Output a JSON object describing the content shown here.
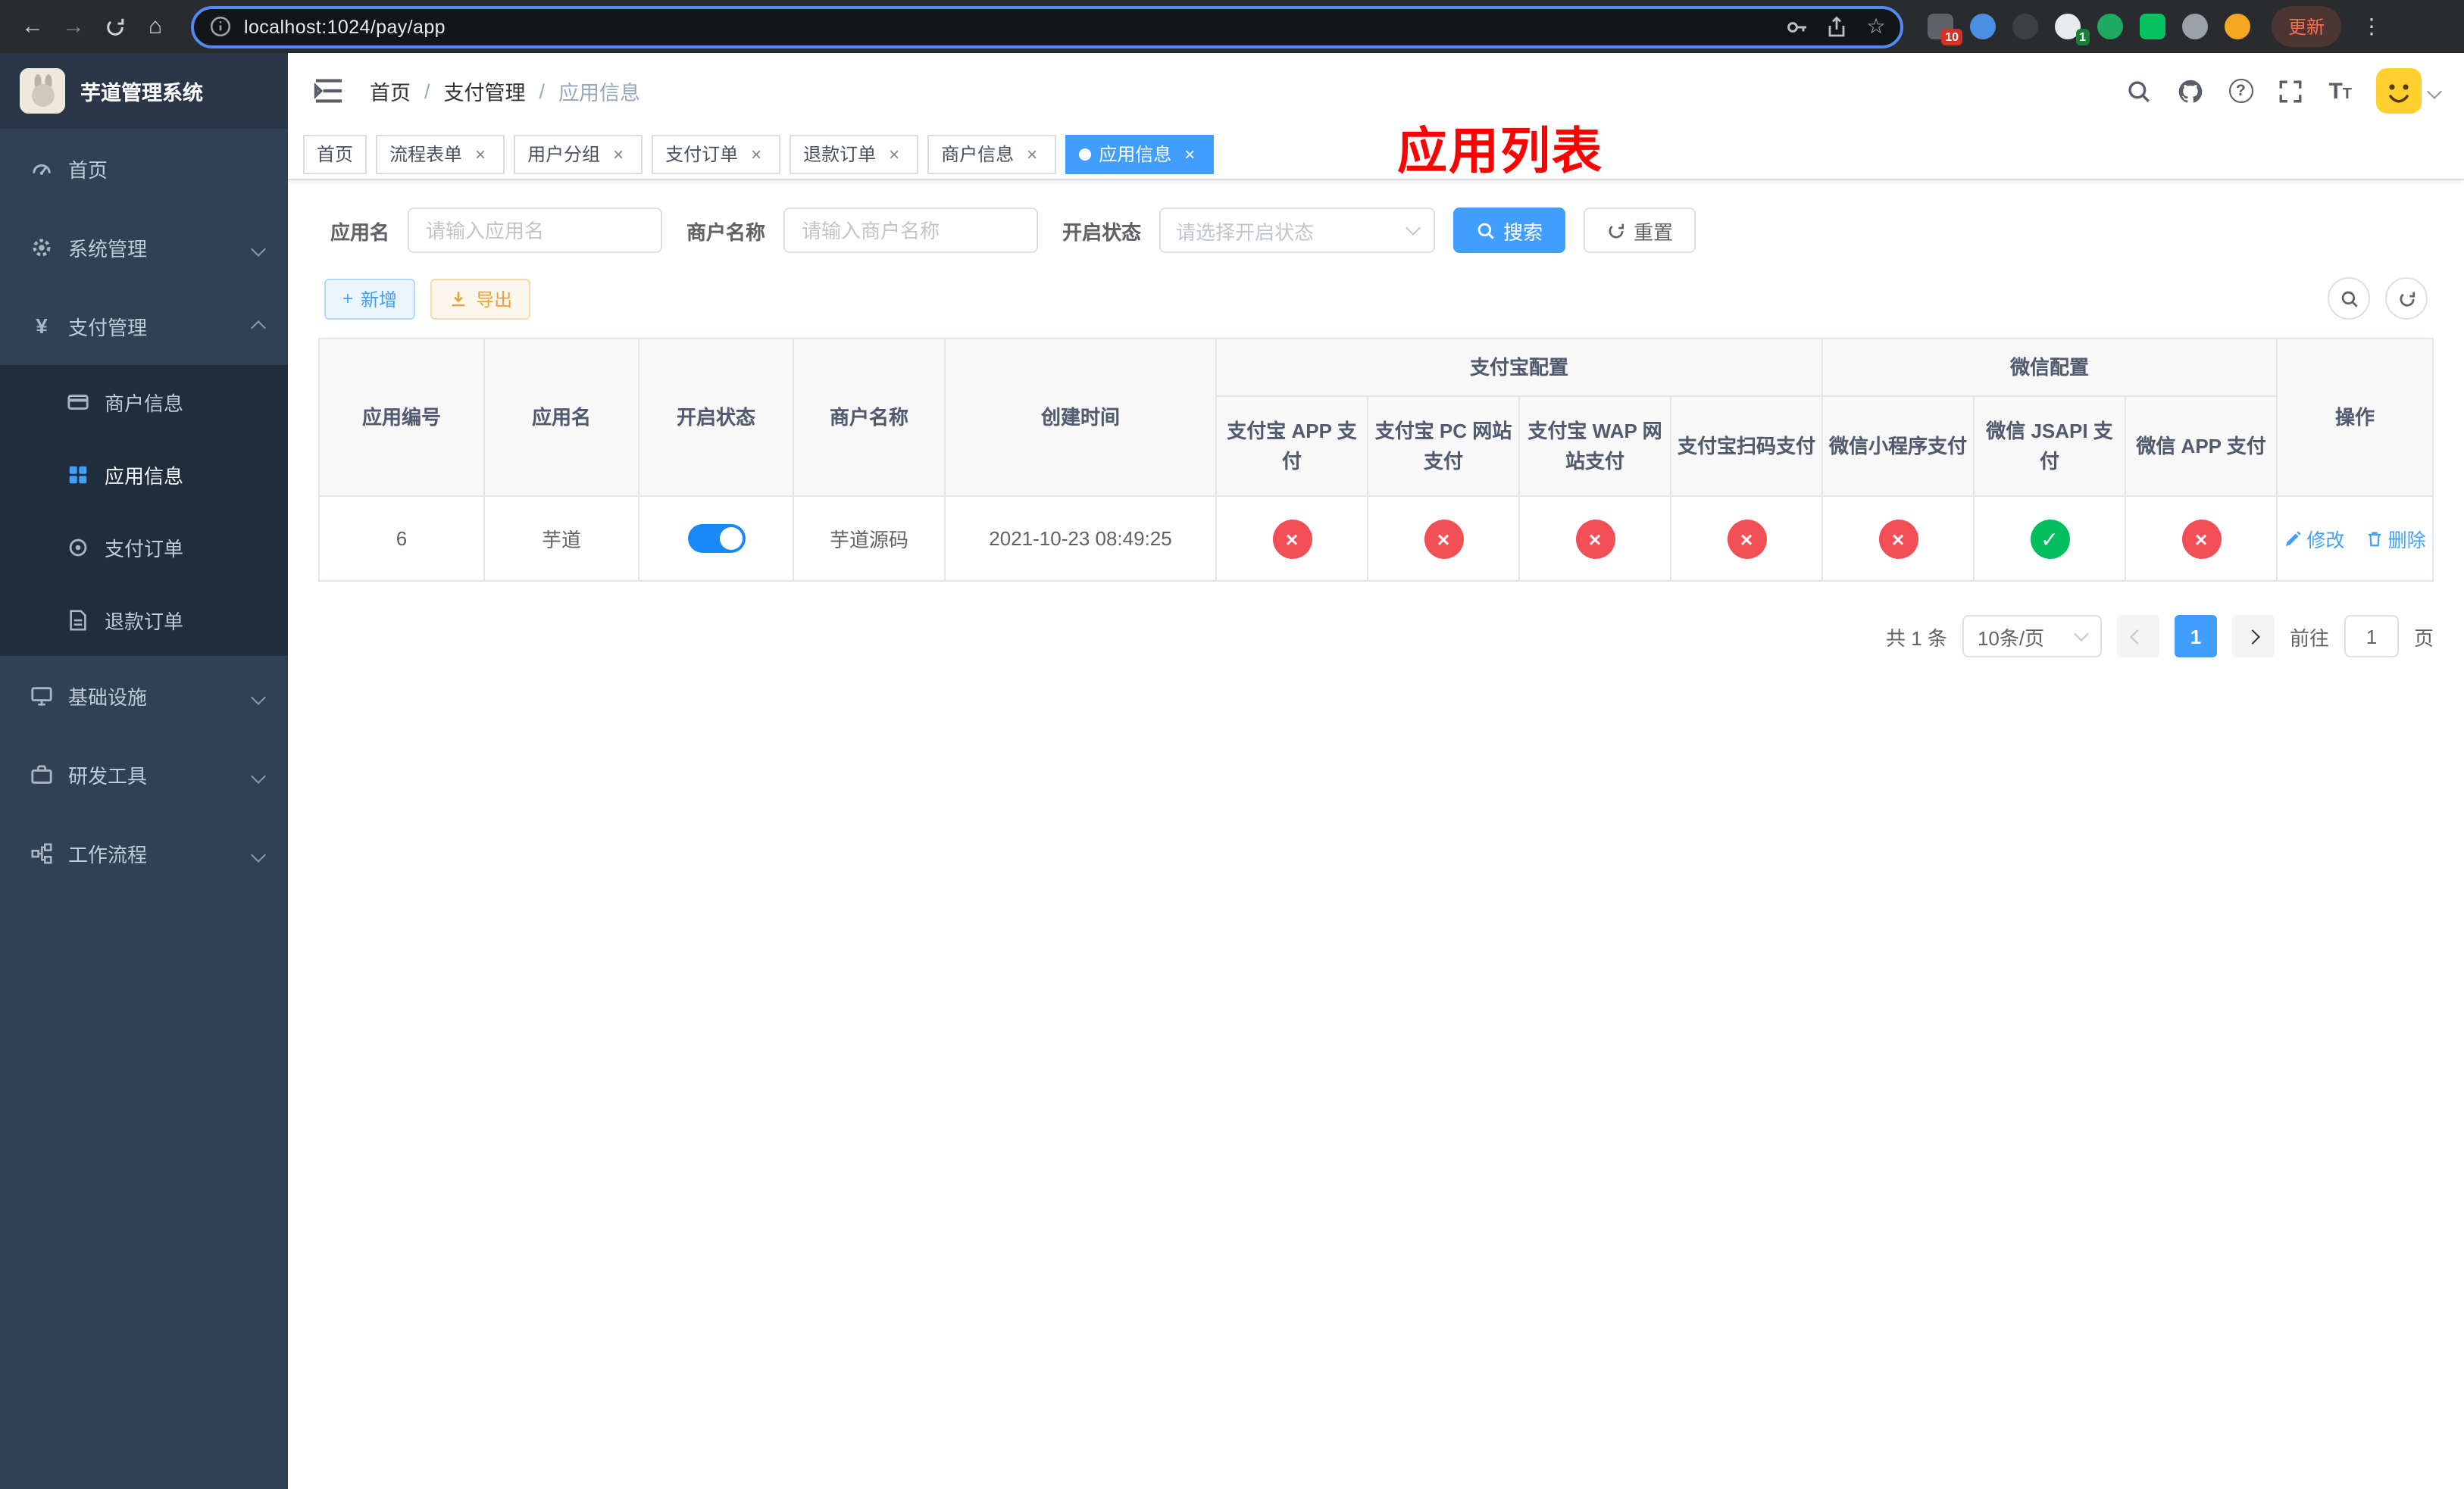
{
  "annotation": {
    "title": "应用列表"
  },
  "browser": {
    "url": "localhost:1024/pay/app",
    "update_label": "更新",
    "extension_badge_1": "10",
    "extension_badge_2": "1"
  },
  "sidebar": {
    "title": "芋道管理系统",
    "items": [
      {
        "label": "首页"
      },
      {
        "label": "系统管理"
      },
      {
        "label": "支付管理"
      },
      {
        "label": "基础设施"
      },
      {
        "label": "研发工具"
      },
      {
        "label": "工作流程"
      }
    ],
    "payment_children": [
      {
        "label": "商户信息"
      },
      {
        "label": "应用信息"
      },
      {
        "label": "支付订单"
      },
      {
        "label": "退款订单"
      }
    ]
  },
  "navbar": {
    "breadcrumb": [
      "首页",
      "支付管理",
      "应用信息"
    ]
  },
  "tabs": [
    {
      "label": "首页"
    },
    {
      "label": "流程表单"
    },
    {
      "label": "用户分组"
    },
    {
      "label": "支付订单"
    },
    {
      "label": "退款订单"
    },
    {
      "label": "商户信息"
    },
    {
      "label": "应用信息"
    }
  ],
  "filters": {
    "app_name_label": "应用名",
    "app_name_placeholder": "请输入应用名",
    "merchant_label": "商户名称",
    "merchant_placeholder": "请输入商户名称",
    "status_label": "开启状态",
    "status_placeholder": "请选择开启状态",
    "search_label": "搜索",
    "reset_label": "重置"
  },
  "toolbar": {
    "add_label": "新增",
    "export_label": "导出"
  },
  "table": {
    "fixed_columns": [
      "应用编号",
      "应用名",
      "开启状态",
      "商户名称",
      "创建时间"
    ],
    "groups": [
      {
        "label": "支付宝配置",
        "columns": [
          "支付宝 APP 支付",
          "支付宝 PC 网站支付",
          "支付宝 WAP 网站支付",
          "支付宝扫码支付"
        ]
      },
      {
        "label": "微信配置",
        "columns": [
          "微信小程序支付",
          "微信 JSAPI 支付",
          "微信 APP 支付"
        ]
      }
    ],
    "actions_column": "操作",
    "rows": [
      {
        "id": "6",
        "name": "芋道",
        "enabled": true,
        "merchant": "芋道源码",
        "created": "2021-10-23 08:49:25",
        "statuses": [
          false,
          false,
          false,
          false,
          false,
          true,
          false
        ],
        "actions": [
          "修改",
          "删除"
        ]
      }
    ]
  },
  "pagination": {
    "total": "共 1 条",
    "page_size": "10条/页",
    "page": "1",
    "goto_label": "前往",
    "goto_value": "1",
    "page_unit": "页"
  },
  "colors": {
    "accent": "#409eff",
    "danger": "#f25056",
    "success": "#00bd5e",
    "warning": "#e6a23c",
    "annotation": "#ff0000",
    "sidebar_bg": "#304156"
  }
}
